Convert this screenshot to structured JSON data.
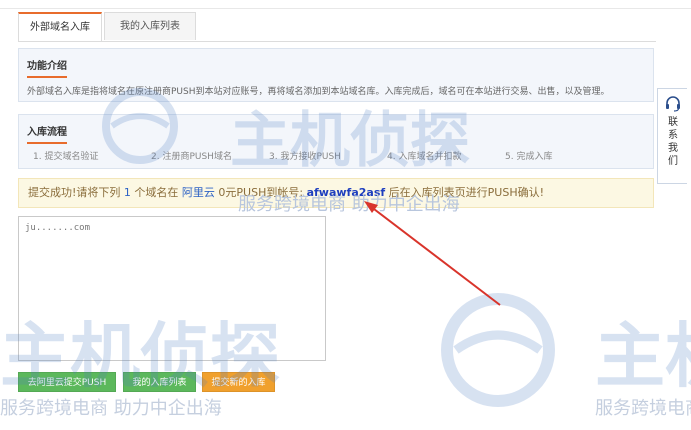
{
  "tabs": [
    {
      "label": "外部域名入库"
    },
    {
      "label": "我的入库列表"
    }
  ],
  "intro": {
    "title": "功能介绍",
    "text": "外部域名入库是指将域名在原注册商PUSH到本站对应账号，再将域名添加到本站域名库。入库完成后，域名可在本站进行交易、出售，以及管理。"
  },
  "process": {
    "title": "入库流程",
    "steps": [
      "1. 提交域名验证",
      "2. 注册商PUSH域名",
      "3. 我方接收PUSH",
      "4. 入库域名并扣款",
      "5. 完成入库"
    ]
  },
  "alert": {
    "prefix": "提交成功!请将下列",
    "count": "1",
    "mid": "个域名在",
    "registrar": "阿里云",
    "mid2": "0元PUSH到帐号:",
    "account": "afwawfa2asf",
    "suffix": "后在入库列表页进行PUSH确认!"
  },
  "domain_list": {
    "value": "ju.......com"
  },
  "buttons": {
    "push_aliyun": "去阿里云提交PUSH",
    "my_list": "我的入库列表",
    "new_submit": "提交新的入库"
  },
  "contact": {
    "chars": [
      "联",
      "系",
      "我",
      "们"
    ]
  },
  "watermark": {
    "brand": "主机侦探",
    "slogan": "服务跨境电商 助力中企出海"
  },
  "colors": {
    "accent": "#e86c2c",
    "green": "#5cb85c",
    "orange": "#f0a02d",
    "link": "#2e63c5"
  },
  "icons": {
    "contact": "headset-icon"
  }
}
